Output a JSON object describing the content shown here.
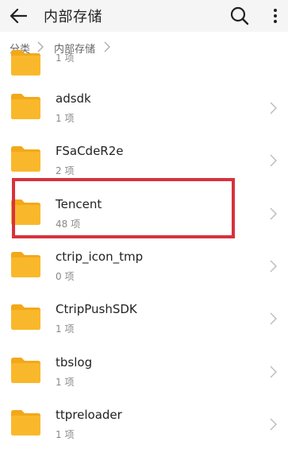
{
  "header": {
    "title": "内部存储",
    "back_icon": "arrow-left-icon",
    "search_icon": "search-icon",
    "more_icon": "more-vertical-icon"
  },
  "breadcrumb": [
    "分类",
    "内部存储"
  ],
  "colors": {
    "folder": "#f9b82b",
    "folder_tab": "#f3a81a",
    "highlight": "#d8323c"
  },
  "items": [
    {
      "name": "",
      "count": "1 项"
    },
    {
      "name": "adsdk",
      "count": "1 项"
    },
    {
      "name": "FSaCdeR2e",
      "count": "2 项"
    },
    {
      "name": "Tencent",
      "count": "48 项"
    },
    {
      "name": "ctrip_icon_tmp",
      "count": "0 项"
    },
    {
      "name": "CtripPushSDK",
      "count": "1 项"
    },
    {
      "name": "tbslog",
      "count": "1 项"
    },
    {
      "name": "ttpreloader",
      "count": "1 项"
    }
  ]
}
